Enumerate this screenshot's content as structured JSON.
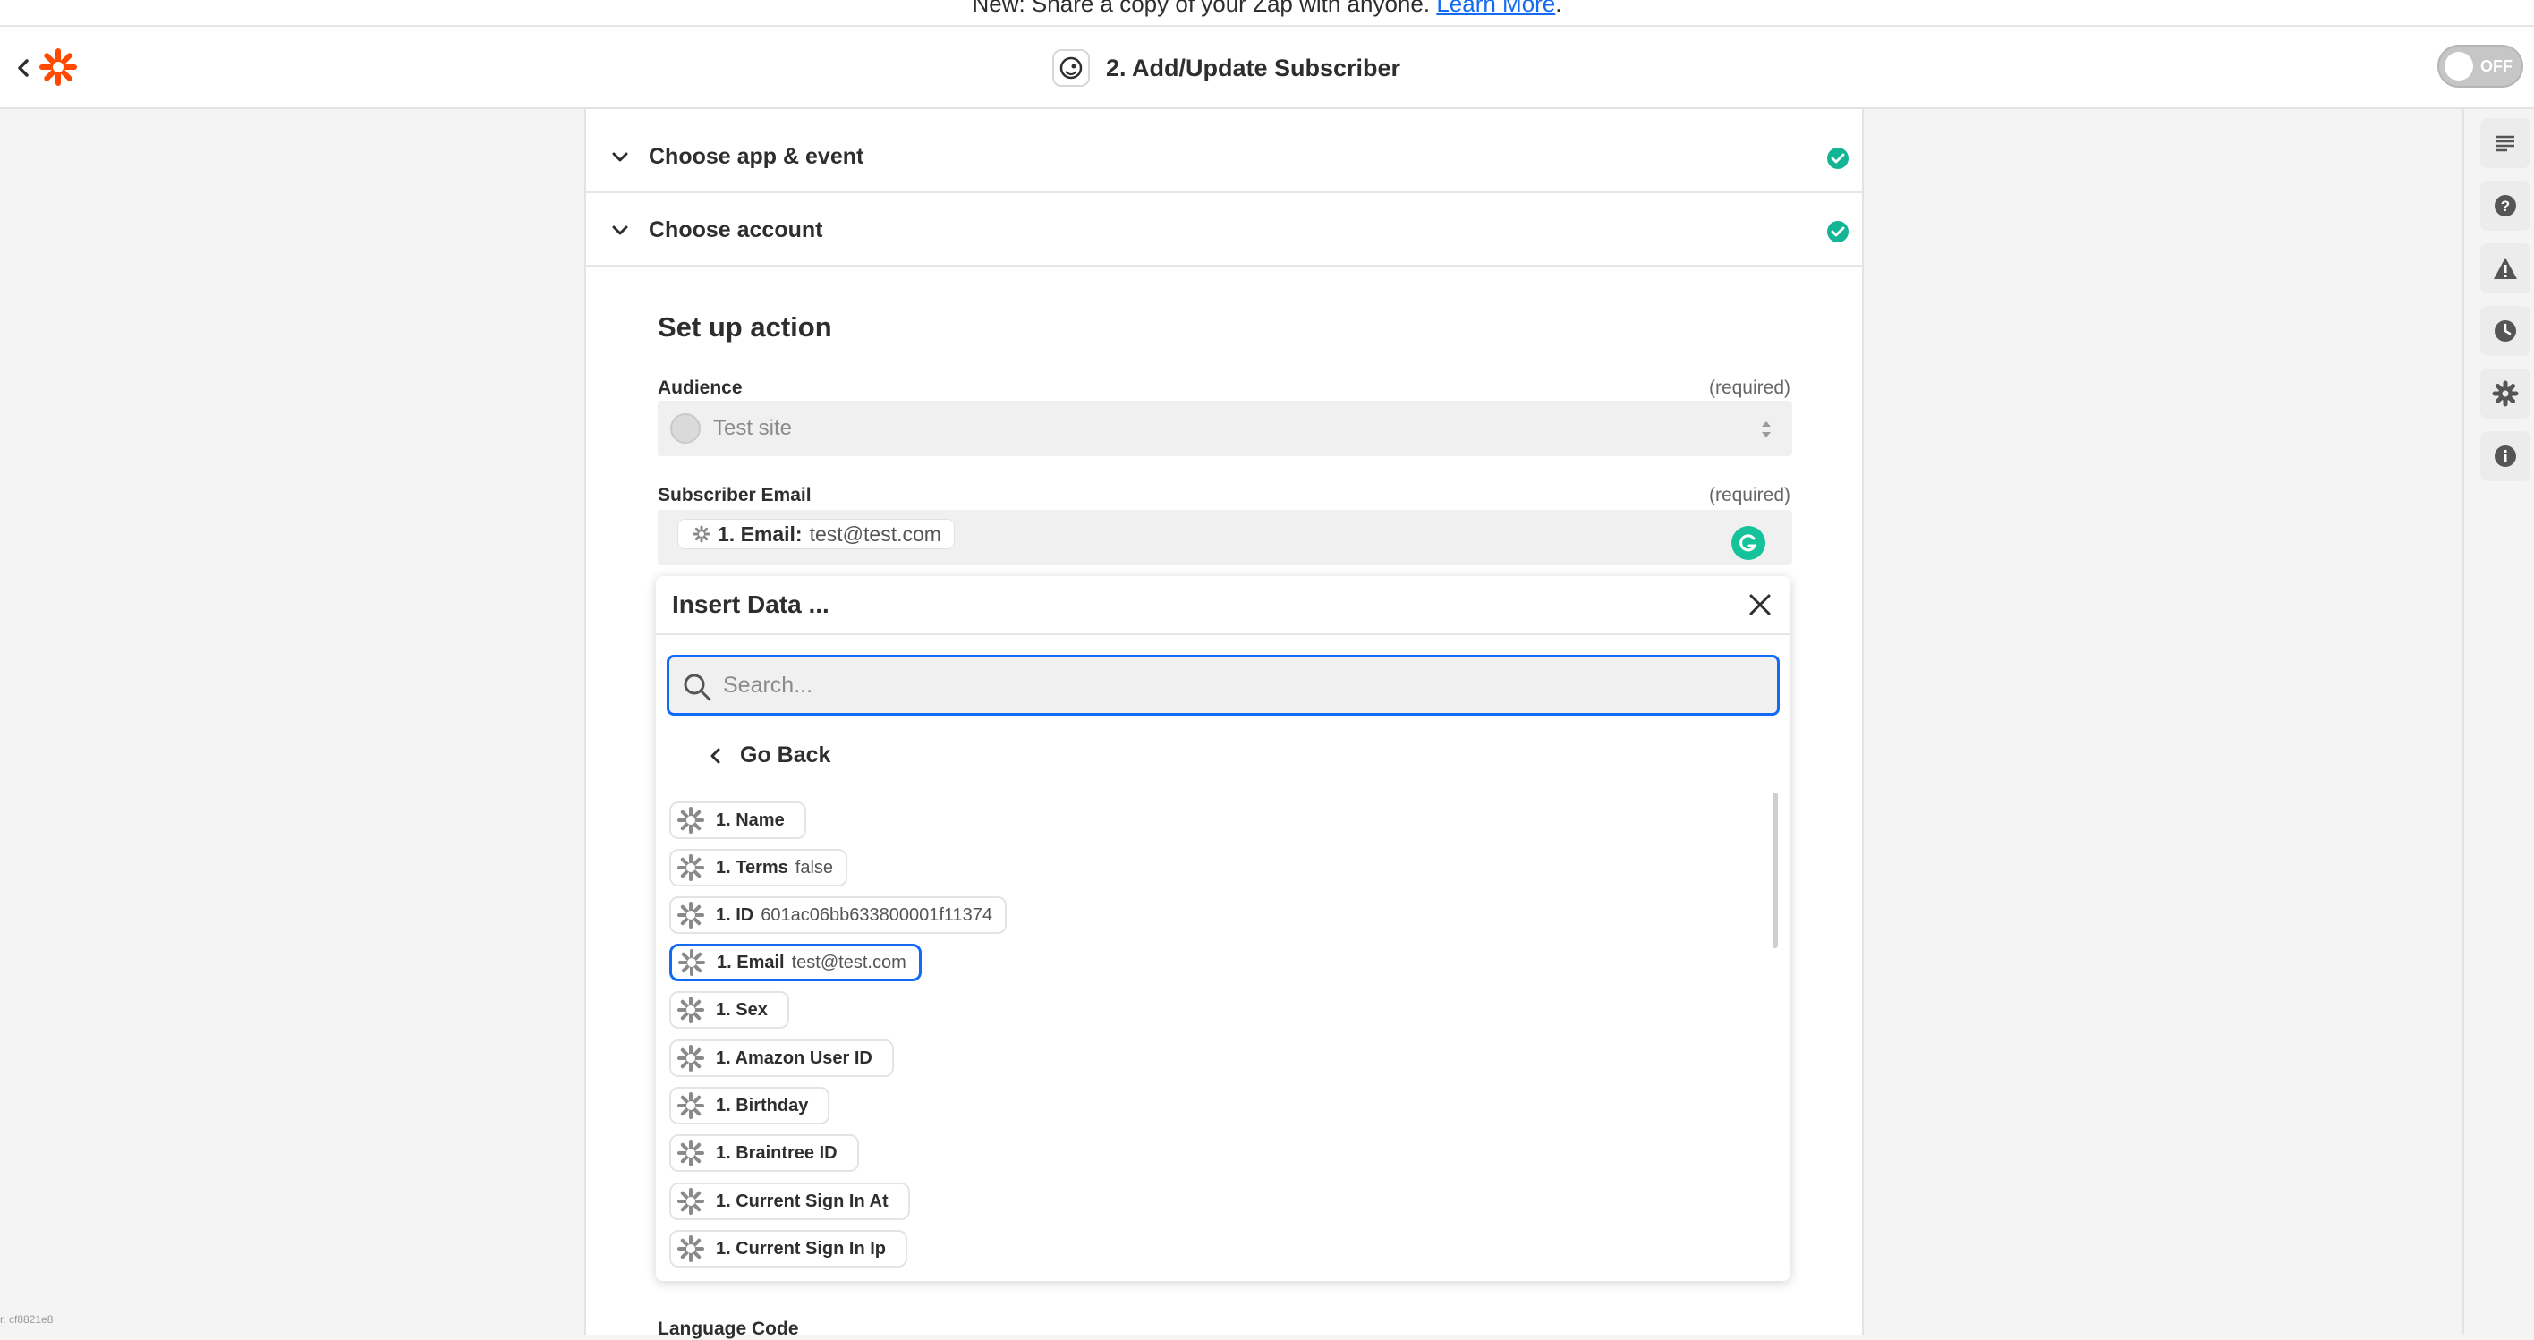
{
  "banner": {
    "text": "New: Share a copy of your Zap with anyone.",
    "link": "Learn More",
    "suffix": "."
  },
  "header": {
    "title": "2. Add/Update Subscriber",
    "toggle_label": "OFF"
  },
  "sections": [
    {
      "label": "Choose app & event"
    },
    {
      "label": "Choose account"
    }
  ],
  "setup": {
    "title": "Set up action",
    "audience": {
      "label": "Audience",
      "required": "(required)",
      "value": "Test site"
    },
    "subscriber_email": {
      "label": "Subscriber Email",
      "required": "(required)",
      "token_key": "1. Email:",
      "token_value": "test@test.com"
    },
    "language_code": {
      "label": "Language Code"
    }
  },
  "insert_data": {
    "title": "Insert Data ...",
    "search_placeholder": "Search...",
    "go_back": "Go Back",
    "items": [
      {
        "key": "1. Name",
        "value": ""
      },
      {
        "key": "1. Terms",
        "value": "false"
      },
      {
        "key": "1. ID",
        "value": "601ac06bb633800001f11374"
      },
      {
        "key": "1. Email",
        "value": "test@test.com"
      },
      {
        "key": "1. Sex",
        "value": ""
      },
      {
        "key": "1. Amazon User ID",
        "value": ""
      },
      {
        "key": "1. Birthday",
        "value": ""
      },
      {
        "key": "1. Braintree ID",
        "value": ""
      },
      {
        "key": "1. Current Sign In At",
        "value": ""
      },
      {
        "key": "1. Current Sign In Ip",
        "value": ""
      }
    ],
    "selected_index": 3
  },
  "version": "r. cf8821e8",
  "colors": {
    "accent": "#136bf5",
    "brand": "#ff4a00",
    "success": "#13b594",
    "grammarly": "#15c39a"
  }
}
